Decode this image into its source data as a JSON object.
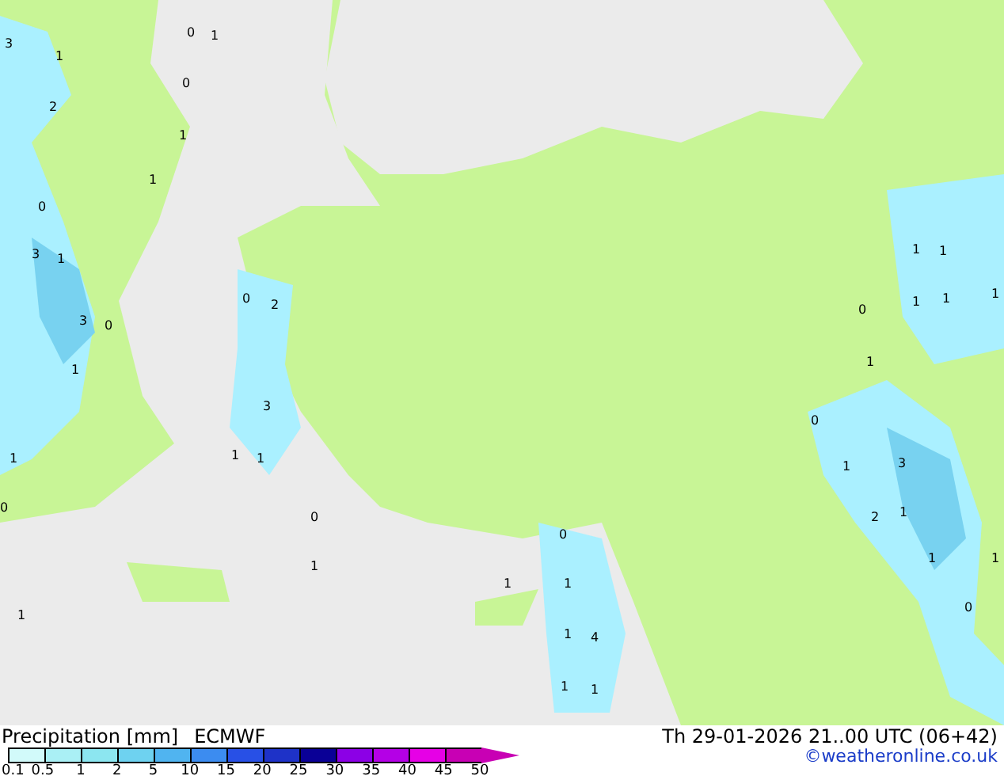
{
  "map": {
    "values": [
      "3",
      "1",
      "2",
      "0",
      "1",
      "0",
      "1",
      "1",
      "0",
      "3",
      "1",
      "3",
      "0",
      "1",
      "0",
      "2",
      "3",
      "1",
      "1",
      "0",
      "1",
      "1",
      "1",
      "0",
      "1",
      "1",
      "4",
      "1",
      "1",
      "1",
      "1",
      "1",
      "1",
      "1",
      "0",
      "1",
      "0",
      "1",
      "3",
      "2",
      "1",
      "1",
      "0",
      "1",
      "0",
      "1"
    ]
  },
  "legend": {
    "title": "Precipitation [mm]",
    "model": "ECMWF",
    "time": "Th 29-01-2026 21..00 UTC (06+42)",
    "credit": "©weatheronline.co.uk",
    "swatches": [
      {
        "color": "#d2fafa"
      },
      {
        "color": "#aaf0f5"
      },
      {
        "color": "#8ce6f0"
      },
      {
        "color": "#6ed2f0"
      },
      {
        "color": "#50b4f0"
      },
      {
        "color": "#3c8cf0"
      },
      {
        "color": "#2850e6"
      },
      {
        "color": "#1e32c8"
      },
      {
        "color": "#0a0096"
      },
      {
        "color": "#8c00e6"
      },
      {
        "color": "#b400e6"
      },
      {
        "color": "#e600e6"
      },
      {
        "color": "#c800b4"
      }
    ],
    "ticks": [
      "0.1",
      "0.5",
      "1",
      "2",
      "5",
      "10",
      "15",
      "20",
      "25",
      "30",
      "35",
      "40",
      "45",
      "50"
    ]
  }
}
